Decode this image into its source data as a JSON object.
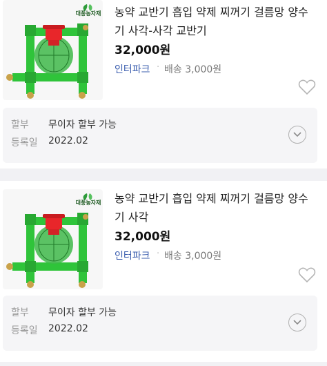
{
  "products": [
    {
      "brand": "대풍농자재",
      "title": "농약 교반기 흡입 약제 찌꺼기 걸름망 양수기 사각-사각 교반기",
      "price": "32,000원",
      "shop": "인터파크",
      "separator": "·",
      "shipping": "배송 3,000원",
      "installment_label": "할부",
      "installment_value": "무이자 할부 가능",
      "registered_label": "등록일",
      "registered_value": "2022.02"
    },
    {
      "brand": "대풍농자재",
      "title": "농약 교반기 흡입 약제 찌꺼기 걸름망 양수기 사각",
      "price": "32,000원",
      "shop": "인터파크",
      "separator": "·",
      "shipping": "배송 3,000원",
      "installment_label": "할부",
      "installment_value": "무이자 할부 가능",
      "registered_label": "등록일",
      "registered_value": "2022.02"
    }
  ],
  "colors": {
    "frame_green": "#2fc43a",
    "cap_red": "#e8262a",
    "shop_blue": "#3a5dae",
    "brass": "#c9a24a"
  },
  "icons": [
    "heart-icon",
    "chevron-down-icon",
    "leaf-logo-icon"
  ]
}
